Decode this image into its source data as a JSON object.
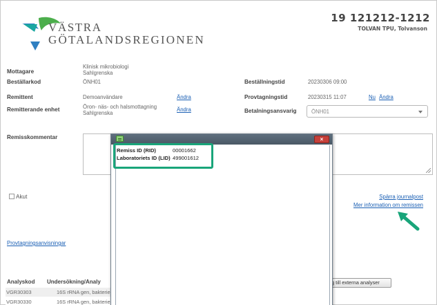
{
  "logo": {
    "line1": "VÄSTRA",
    "line2": "GÖTALANDSREGIONEN"
  },
  "patient": {
    "id": "19 121212-1212",
    "name": "TOLVAN TPU, Tolvanson"
  },
  "form": {
    "mottagare": {
      "label": "Mottagare",
      "value_line1": "Klinisk mikrobiologi",
      "value_line2": "Sahlgrenska"
    },
    "bestallarkod": {
      "label": "Beställarkod",
      "value": "ÖNH01"
    },
    "remittent": {
      "label": "Remittent",
      "value": "Demoanvändare",
      "link": "Ändra"
    },
    "remitterande_enhet": {
      "label": "Remitterande enhet",
      "value_line1": "Öron- näs- och halsmottagning",
      "value_line2": "Sahlgrenska",
      "link": "Ändra"
    },
    "bestallningstid": {
      "label": "Beställningstid",
      "value": "20230306 09:00"
    },
    "provtagningstid": {
      "label": "Provtagningstid",
      "value": "20230315 11:07",
      "link_now": "Nu",
      "link_change": "Ändra"
    },
    "betalningsansvarig": {
      "label": "Betalningsansvarig",
      "value": "ÖNH01"
    },
    "remisskommentar": {
      "label": "Remisskommentar"
    },
    "akut": {
      "label": "Akut",
      "checked": false
    },
    "sparra_journalpost": "Spärra journalpost",
    "mer_information": "Mer information om remissen",
    "provtagningsanvisningar": "Provtagningsanvisningar"
  },
  "modal": {
    "close_symbol": "×",
    "remiss_id_label": "Remiss ID (RID)",
    "remiss_id_value": "00001662",
    "lab_id_label": "Laboratoriets ID (LID)",
    "lab_id_value": "499001612"
  },
  "table": {
    "headers": {
      "analyskod": "Analyskod",
      "undersokning": "Undersökning/Analy"
    },
    "rows": [
      {
        "code": "VGR30303",
        "desc": "16S rRNA gen, bakterie"
      },
      {
        "code": "VGR30330",
        "desc": "16S rRNA gen, bakterie"
      }
    ],
    "external_button": "g till externa analyser"
  },
  "colors": {
    "highlight": "#19a57a",
    "arrow": "#19a57a",
    "link": "#1a5fb4",
    "logo_teal": "#1aa7a1",
    "logo_blue": "#2f7fc1",
    "logo_green": "#4cae4c"
  }
}
